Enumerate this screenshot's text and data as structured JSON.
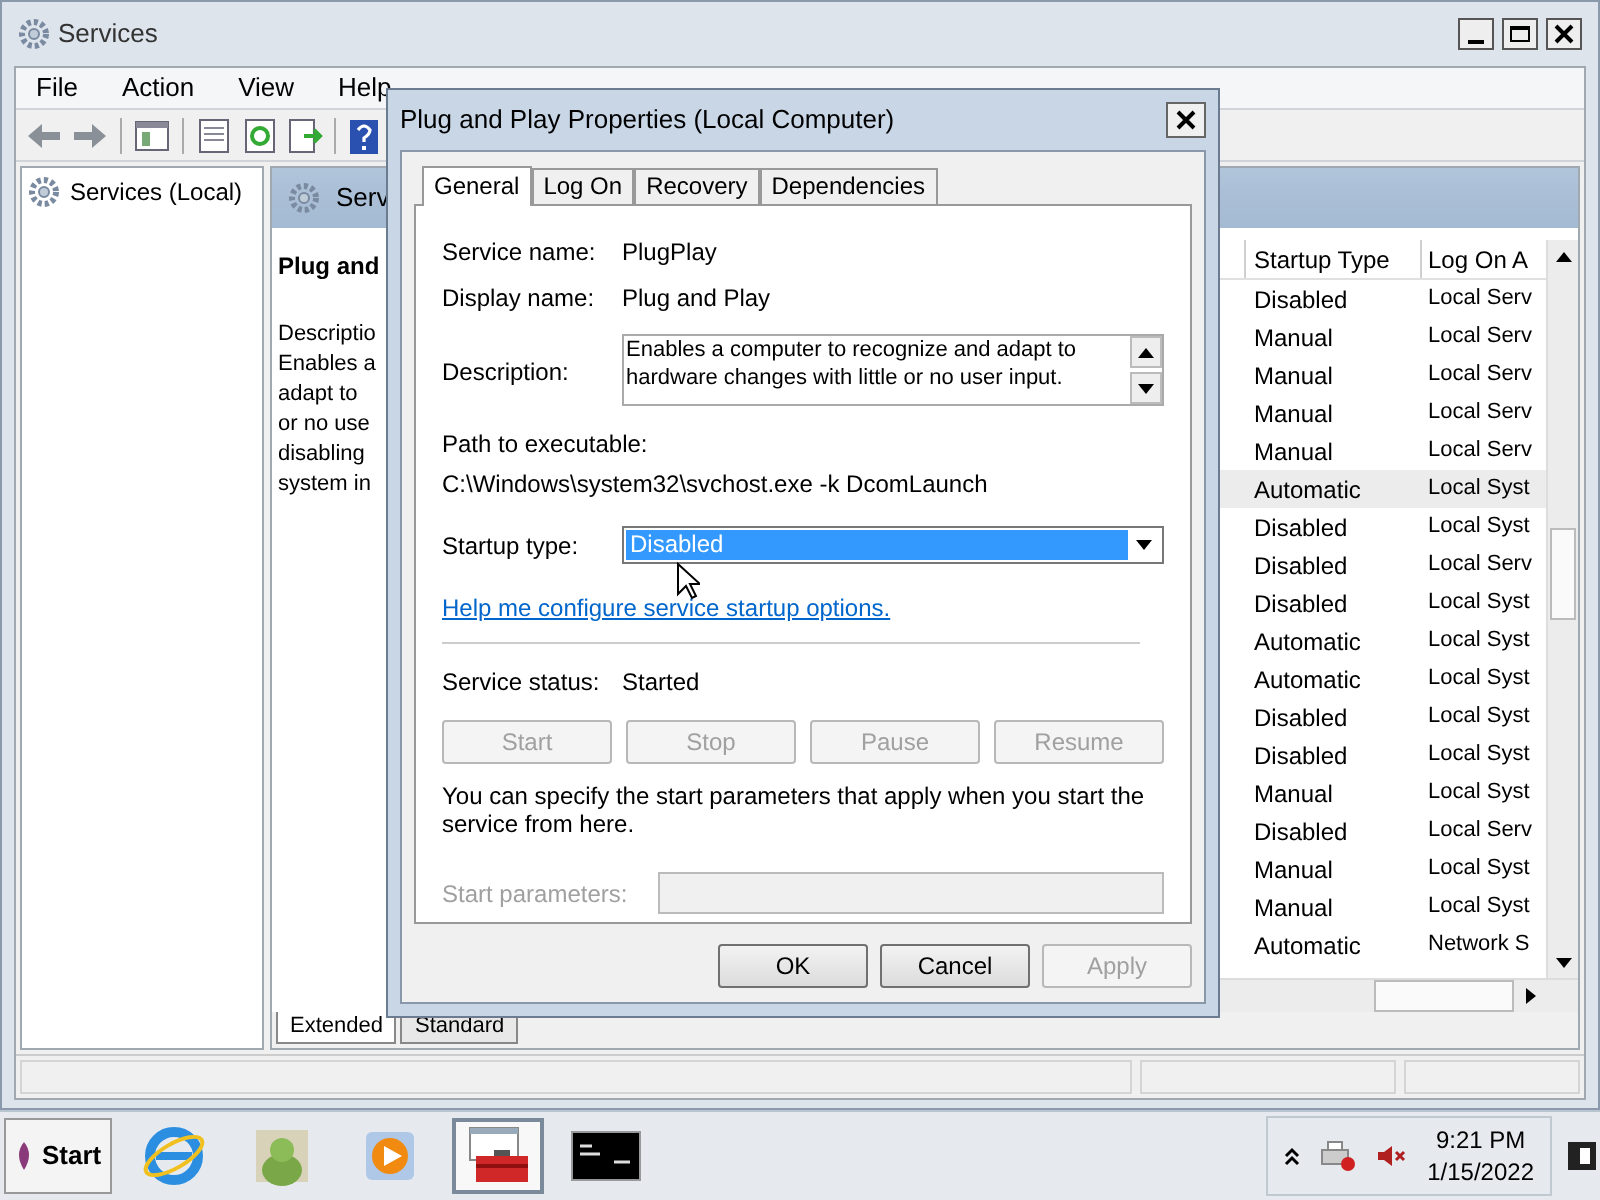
{
  "window": {
    "title": "Services"
  },
  "menu": [
    "File",
    "Action",
    "View",
    "Help"
  ],
  "tree": [
    {
      "label": "Services (Local)",
      "selected": false
    }
  ],
  "pane_header": "Serv",
  "detail": {
    "title": "Plug and",
    "lines": [
      "Descriptio",
      "Enables a",
      "adapt to",
      "or no use",
      "disabling",
      "system in"
    ]
  },
  "list": {
    "columns": [
      "Startup Type",
      "Log On A"
    ],
    "rows": [
      {
        "startup": "Disabled",
        "logon": "Local Serv",
        "selected": false
      },
      {
        "startup": "Manual",
        "logon": "Local Serv",
        "selected": false
      },
      {
        "startup": "Manual",
        "logon": "Local Serv",
        "selected": false
      },
      {
        "startup": "Manual",
        "logon": "Local Serv",
        "selected": false
      },
      {
        "startup": "Manual",
        "logon": "Local Serv",
        "selected": false
      },
      {
        "startup": "Automatic",
        "logon": "Local Syst",
        "selected": true
      },
      {
        "startup": "Disabled",
        "logon": "Local Syst",
        "selected": false
      },
      {
        "startup": "Disabled",
        "logon": "Local Serv",
        "selected": false
      },
      {
        "startup": "Disabled",
        "logon": "Local Syst",
        "selected": false
      },
      {
        "startup": "Automatic",
        "logon": "Local Syst",
        "selected": false
      },
      {
        "startup": "Automatic",
        "logon": "Local Syst",
        "selected": false
      },
      {
        "startup": "Disabled",
        "logon": "Local Syst",
        "selected": false
      },
      {
        "startup": "Disabled",
        "logon": "Local Syst",
        "selected": false
      },
      {
        "startup": "Manual",
        "logon": "Local Syst",
        "selected": false
      },
      {
        "startup": "Disabled",
        "logon": "Local Serv",
        "selected": false
      },
      {
        "startup": "Manual",
        "logon": "Local Syst",
        "selected": false
      },
      {
        "startup": "Manual",
        "logon": "Local Syst",
        "selected": false
      },
      {
        "startup": "Automatic",
        "logon": "Network S",
        "selected": false
      }
    ]
  },
  "view_tabs": [
    {
      "label": "Extended",
      "selected": true
    },
    {
      "label": "Standard",
      "selected": false
    }
  ],
  "dialog": {
    "title": "Plug and Play Properties (Local Computer)",
    "tabs": [
      {
        "label": "General",
        "selected": true
      },
      {
        "label": "Log On",
        "selected": false
      },
      {
        "label": "Recovery",
        "selected": false
      },
      {
        "label": "Dependencies",
        "selected": false
      }
    ],
    "fields": [
      {
        "label": "Service name:",
        "value": "PlugPlay"
      },
      {
        "label": "Display name:",
        "value": "Plug and Play"
      }
    ],
    "description": {
      "label": "Description:",
      "value": "Enables a computer to recognize and adapt to hardware changes with little or no user input."
    },
    "path": {
      "label": "Path to executable:",
      "value": "C:\\Windows\\system32\\svchost.exe -k DcomLaunch"
    },
    "startup": {
      "label": "Startup type:",
      "value": "Disabled"
    },
    "help_link": "Help me configure service startup options.",
    "status": {
      "label": "Service status:",
      "value": "Started"
    },
    "control_buttons": [
      {
        "label": "Start",
        "disabled": true
      },
      {
        "label": "Stop",
        "disabled": true
      },
      {
        "label": "Pause",
        "disabled": true
      },
      {
        "label": "Resume",
        "disabled": true
      }
    ],
    "note": "You can specify the start parameters that apply when you start the service from here.",
    "parameters": {
      "label": "Start parameters:",
      "disabled": true
    },
    "buttons": [
      {
        "label": "OK",
        "disabled": false
      },
      {
        "label": "Cancel",
        "disabled": false
      },
      {
        "label": "Apply",
        "disabled": true
      }
    ]
  },
  "taskbar": {
    "start": "Start",
    "apps": [
      {
        "kind": "browser",
        "active": false
      },
      {
        "kind": "picture-app",
        "active": false
      },
      {
        "kind": "media",
        "active": false
      },
      {
        "kind": "toolbox",
        "active": true
      },
      {
        "kind": "console",
        "active": false
      }
    ],
    "clock": {
      "time": "9:21 PM",
      "date": "1/15/2022"
    }
  }
}
